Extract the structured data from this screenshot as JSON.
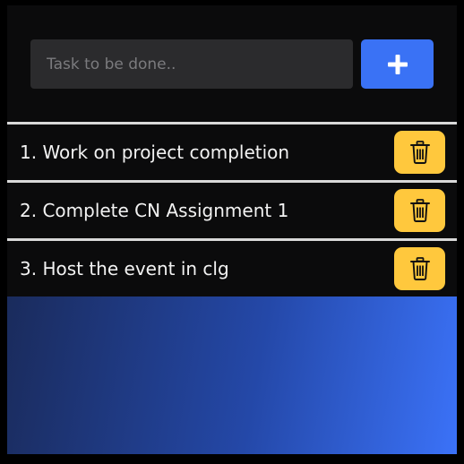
{
  "input": {
    "placeholder": "Task to be done..",
    "value": ""
  },
  "add_button": {
    "icon": "plus-icon"
  },
  "tasks": [
    {
      "label": "1. Work on project completion",
      "delete_icon": "trash-icon"
    },
    {
      "label": "2. Complete CN Assignment 1",
      "delete_icon": "trash-icon"
    },
    {
      "label": "3. Host the event in clg",
      "delete_icon": "trash-icon"
    }
  ],
  "colors": {
    "background": "#0b0b0c",
    "input_bg": "#2b2b2d",
    "accent_blue": "#3a72f5",
    "delete_yellow": "#ffc83d",
    "divider": "#d9d9d9",
    "gradient_start": "#1a2b5c",
    "gradient_end": "#3b72f8"
  }
}
